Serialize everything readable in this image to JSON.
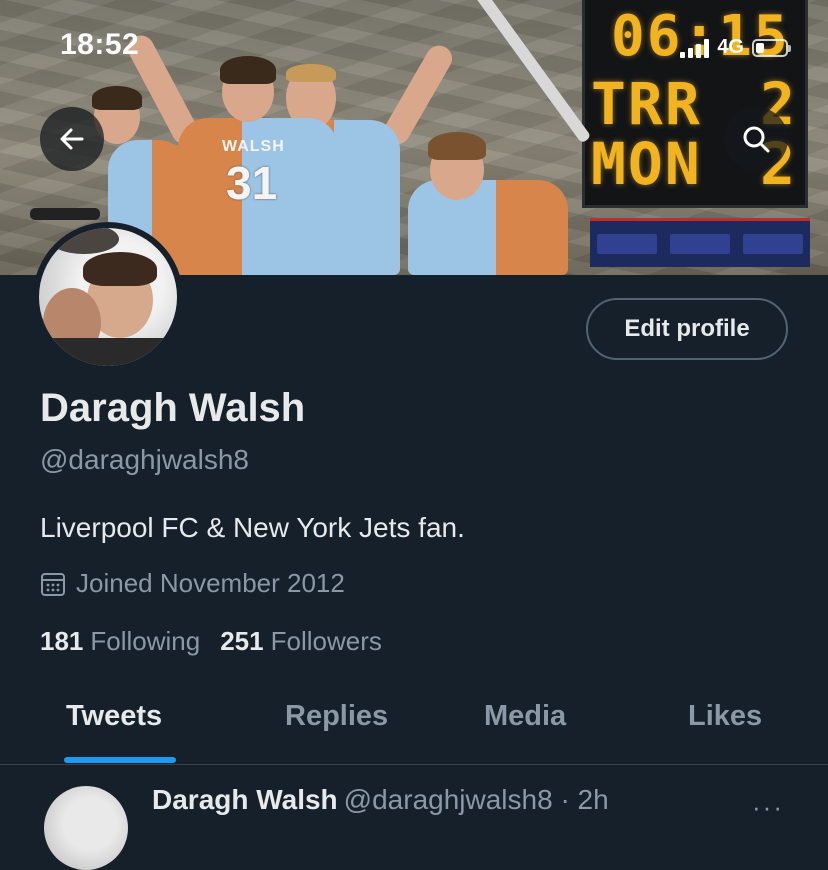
{
  "status_bar": {
    "time": "18:52",
    "network": "4G",
    "battery_level": 0.3
  },
  "banner": {
    "scoreboard": {
      "clock": "06:15",
      "home_team": "TRR",
      "home_score": "2",
      "away_team": "MON",
      "away_score": "2"
    },
    "jersey_name": "WALSH",
    "jersey_number": "31"
  },
  "header": {
    "back_icon": "arrow-left-icon",
    "search_icon": "search-icon"
  },
  "profile": {
    "edit_label": "Edit profile",
    "display_name": "Daragh Walsh",
    "handle": "@daraghjwalsh8",
    "bio": "Liverpool FC & New York Jets fan.",
    "joined": "Joined November 2012",
    "following_count": "181",
    "following_label": "Following",
    "followers_count": "251",
    "followers_label": "Followers"
  },
  "tabs": [
    {
      "label": "Tweets",
      "active": true
    },
    {
      "label": "Replies",
      "active": false
    },
    {
      "label": "Media",
      "active": false
    },
    {
      "label": "Likes",
      "active": false
    }
  ],
  "tweet_preview": {
    "name": "Daragh Walsh",
    "meta": "@daraghjwalsh8 · 2h",
    "more": "···"
  },
  "colors": {
    "background": "#15202b",
    "accent": "#1d9bf0",
    "muted_text": "#8b98a5",
    "primary_text": "#e7e9ea",
    "scoreboard_digits": "#f2b321"
  }
}
